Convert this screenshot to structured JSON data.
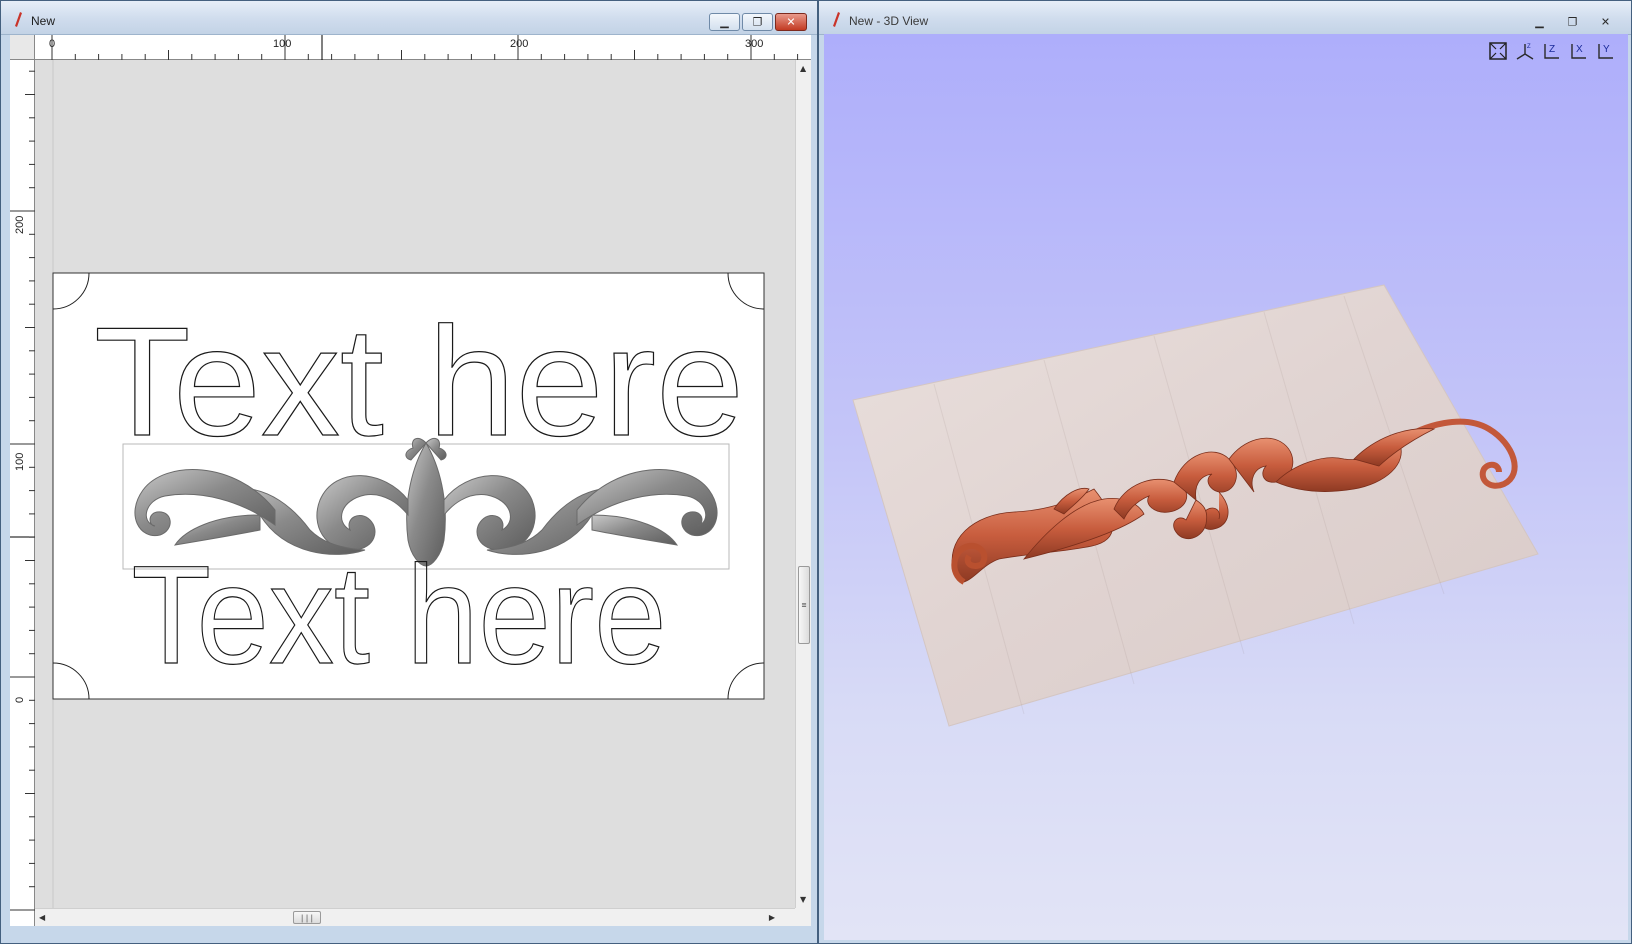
{
  "window_2d": {
    "title": "New",
    "ruler_h_labels": [
      "0",
      "100",
      "200",
      "300"
    ],
    "ruler_v_labels": [
      "200",
      "100",
      "0"
    ],
    "design_text_top": "Text here",
    "design_text_bottom": "Text here"
  },
  "window_3d": {
    "title": "New - 3D View",
    "view_buttons": [
      "fit-view-icon",
      "iso-view-icon",
      "top-view-z-icon",
      "front-view-x-icon",
      "side-view-y-icon"
    ]
  },
  "colors": {
    "title_bg": "#cfdced",
    "canvas_bg": "#dedede",
    "bg3d_top": "#aeaefb",
    "bg3d_bottom": "#e2e4f6",
    "relief_3d": "#c85d3e",
    "relief_2d": "#8c8c8c",
    "wood": "#e4d8d6"
  }
}
